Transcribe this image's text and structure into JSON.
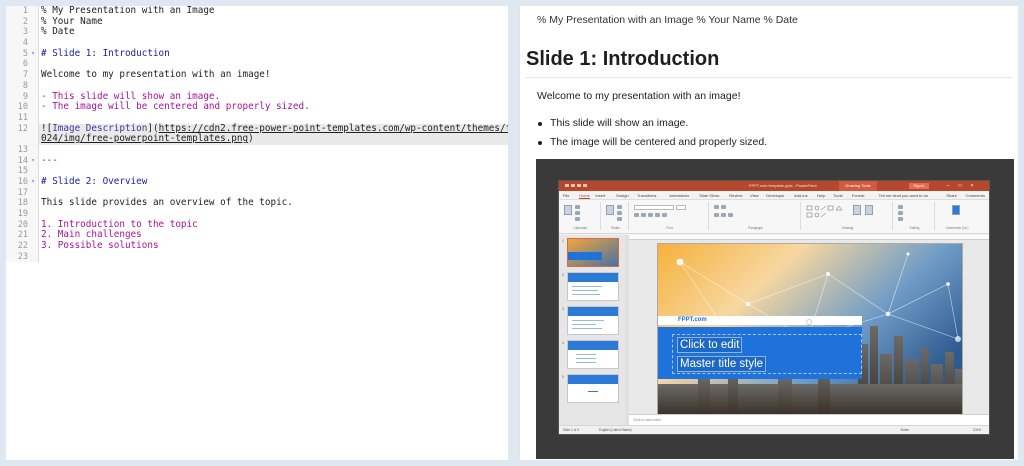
{
  "editor": {
    "lines": [
      {
        "num": "1",
        "text": "% My Presentation with an Image",
        "kind": "plain"
      },
      {
        "num": "2",
        "text": "% Your Name",
        "kind": "plain"
      },
      {
        "num": "3",
        "text": "% Date",
        "kind": "plain"
      },
      {
        "num": "4",
        "text": "",
        "kind": "plain"
      },
      {
        "num": "5",
        "text": "# Slide 1: Introduction",
        "kind": "head",
        "fold": true
      },
      {
        "num": "6",
        "text": "",
        "kind": "plain"
      },
      {
        "num": "7",
        "text": "Welcome to my presentation with an image!",
        "kind": "plain"
      },
      {
        "num": "8",
        "text": "",
        "kind": "plain"
      },
      {
        "num": "9",
        "text": "- This slide will show an image.",
        "kind": "list"
      },
      {
        "num": "10",
        "text": "- The image will be centered and properly sized.",
        "kind": "list"
      },
      {
        "num": "11",
        "text": "",
        "kind": "plain"
      },
      {
        "num": "12",
        "text_prefix": "![",
        "link_text": "Image Description",
        "link_mid": "](",
        "url_a": "https://cdn2.free-power-point-templates.com/wp-content/themes/fppt-2",
        "kind": "link"
      },
      {
        "num": "",
        "url_b": "024/img/free-powerpoint-templates.png",
        "link_end": ")",
        "kind": "link-cont"
      },
      {
        "num": "13",
        "text": "",
        "kind": "plain"
      },
      {
        "num": "14",
        "text": "---",
        "kind": "rule",
        "fold": true
      },
      {
        "num": "15",
        "text": "",
        "kind": "plain"
      },
      {
        "num": "16",
        "text": "# Slide 2: Overview",
        "kind": "head",
        "fold": true
      },
      {
        "num": "17",
        "text": "",
        "kind": "plain"
      },
      {
        "num": "18",
        "text": "This slide provides an overview of the topic.",
        "kind": "plain"
      },
      {
        "num": "19",
        "text": "",
        "kind": "plain"
      },
      {
        "num": "20",
        "text": "1. Introduction to the topic",
        "kind": "list"
      },
      {
        "num": "21",
        "text": "2. Main challenges",
        "kind": "list"
      },
      {
        "num": "22",
        "text": "3. Possible solutions",
        "kind": "list"
      },
      {
        "num": "23",
        "text": "",
        "kind": "plain"
      }
    ],
    "fold_glyph": "▾"
  },
  "preview": {
    "meta_line": "% My Presentation with an Image % Your Name % Date",
    "heading": "Slide 1: Introduction",
    "paragraph": "Welcome to my presentation with an image!",
    "bullets": [
      "This slide will show an image.",
      "The image will be centered and properly sized."
    ]
  },
  "image": {
    "window_title": "FPPT.com template.pptx - PowerPoint",
    "drawing_tools": "Drawing Tools",
    "signin": "Sign in",
    "tabs": [
      "File",
      "Home",
      "Insert",
      "Design",
      "Transitions",
      "Animations",
      "Slide Show",
      "Review",
      "View",
      "Developer",
      "Add-ins",
      "Help",
      "Tools",
      "Format"
    ],
    "tell_me": "Tell me what you want to do",
    "share": "Share",
    "comments": "Comments",
    "ribbon_groups": [
      "Clipboard",
      "Slides",
      "Font",
      "Paragraph",
      "Drawing",
      "Editing",
      "Comments (Int.)"
    ],
    "slide_brand": "FPPT.com",
    "slide_title_1": "Click to edit",
    "slide_title_2": "Master title style",
    "notes_placeholder": "Click to add notes",
    "status_left": "Slide 1 of 5",
    "status_lang": "English (United States)",
    "status_right": "Notes",
    "zoom": "104%"
  },
  "colors": {
    "heading_md": "#1a1aa6",
    "list_md": "#aa1199",
    "ppt_accent": "#b7472a",
    "slide_blue": "#1f72d9"
  }
}
